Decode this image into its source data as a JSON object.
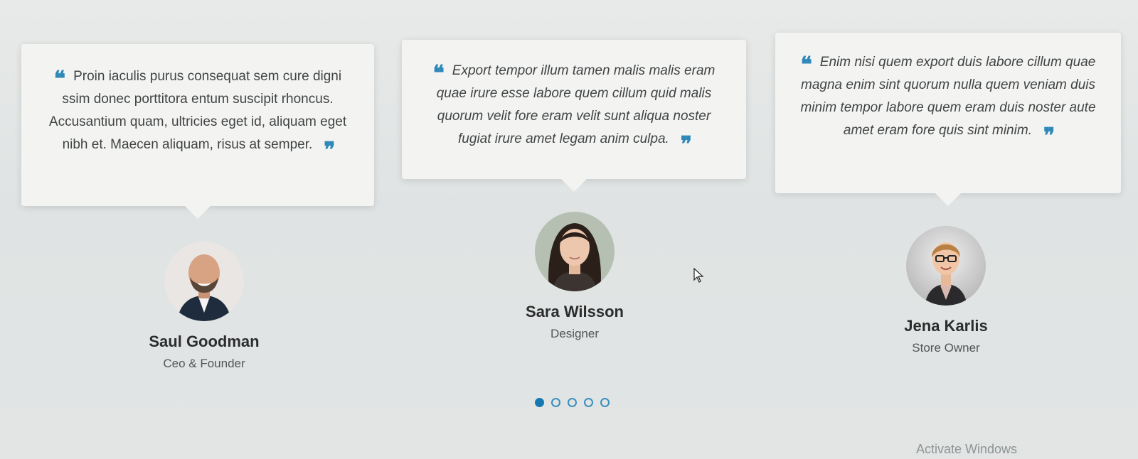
{
  "testimonials": [
    {
      "quote": "Proin iaculis purus consequat sem cure digni ssim donec porttitora entum suscipit rhoncus. Accusantium quam, ultricies eget id, aliquam eget nibh et. Maecen aliquam, risus at semper.",
      "name": "Saul Goodman",
      "role": "Ceo & Founder"
    },
    {
      "quote": "Export tempor illum tamen malis malis eram quae irure esse labore quem cillum quid malis quorum velit fore eram velit sunt aliqua noster fugiat irure amet legam anim culpa.",
      "name": "Sara Wilsson",
      "role": "Designer"
    },
    {
      "quote": "Enim nisi quem export duis labore cillum quae magna enim sint quorum nulla quem veniam duis minim tempor labore quem eram duis noster aute amet eram fore quis sint minim.",
      "name": "Jena Karlis",
      "role": "Store Owner"
    }
  ],
  "quote_open": "❝",
  "quote_close": "❞",
  "pagination": {
    "count": 5,
    "active_index": 0
  },
  "watermark": "Activate Windows",
  "colors": {
    "accent": "#2e88b8",
    "card": "#f3f3f2",
    "dot_active": "#1678b0"
  }
}
